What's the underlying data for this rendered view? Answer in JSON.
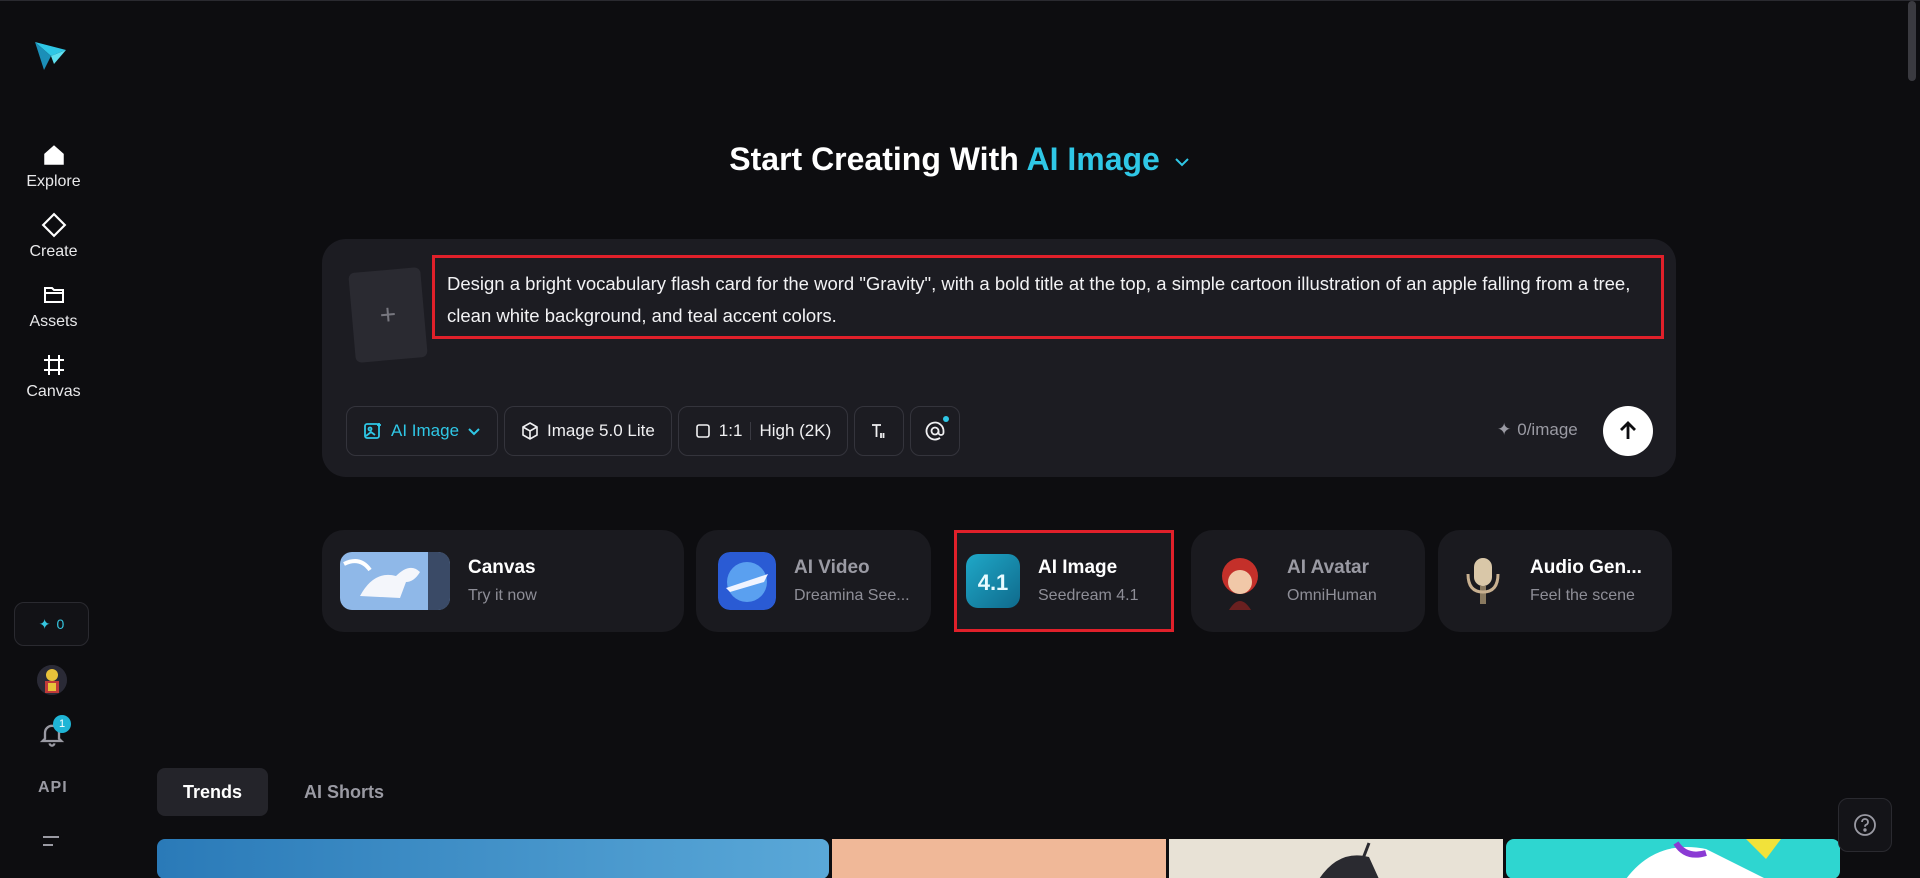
{
  "sidebar": {
    "items": [
      {
        "label": "Explore",
        "icon": "home-icon"
      },
      {
        "label": "Create",
        "icon": "diamond-icon"
      },
      {
        "label": "Assets",
        "icon": "folder-icon"
      },
      {
        "label": "Canvas",
        "icon": "frame-icon"
      }
    ],
    "credits": "0",
    "notifications": "1",
    "api_label": "API"
  },
  "heading": {
    "prefix": "Start Creating With",
    "mode": "AI Image"
  },
  "prompt": {
    "text": "Design a bright vocabulary flash card for the word \"Gravity\", with a bold title at the top, a simple cartoon illustration of an apple falling from a tree, clean white background, and teal accent colors.",
    "upload_symbol": "+"
  },
  "toolbar": {
    "mode_label": "AI Image",
    "model_label": "Image 5.0 Lite",
    "ratio_label": "1:1",
    "quality_label": "High (2K)",
    "cost_label": "0/image"
  },
  "features": [
    {
      "title": "Canvas",
      "subtitle": "Try it now"
    },
    {
      "title": "AI Video",
      "subtitle": "Dreamina See..."
    },
    {
      "title": "AI Image",
      "subtitle": "Seedream 4.1",
      "badge": "4.1"
    },
    {
      "title": "AI Avatar",
      "subtitle": "OmniHuman"
    },
    {
      "title": "Audio Gen...",
      "subtitle": "Feel the scene"
    }
  ],
  "tabs": [
    {
      "label": "Trends",
      "active": true
    },
    {
      "label": "AI Shorts",
      "active": false
    }
  ],
  "colors": {
    "accent": "#2fc7e6",
    "background": "#0d0d10",
    "card": "#1c1c22",
    "highlight": "#e0202a"
  }
}
